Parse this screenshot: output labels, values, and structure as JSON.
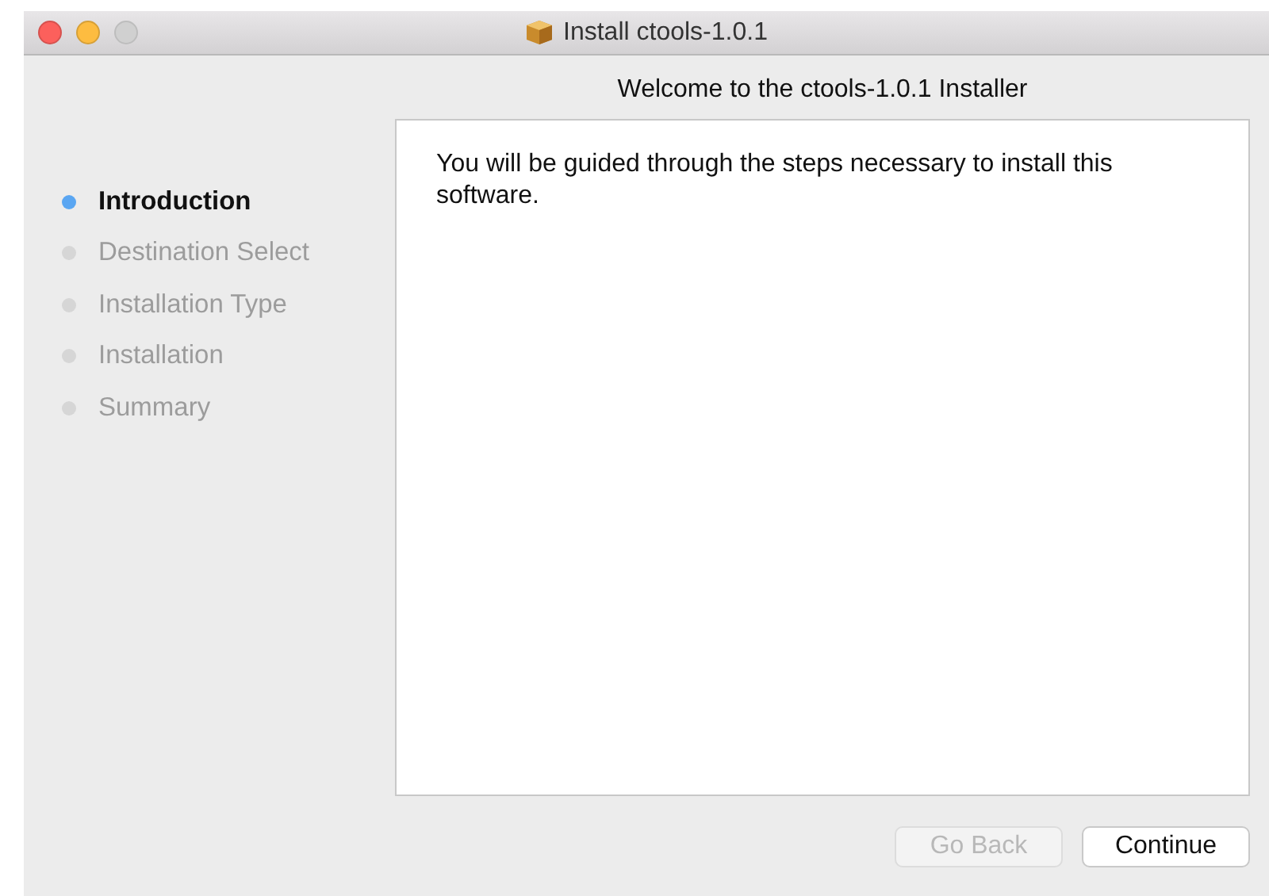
{
  "window": {
    "title": "Install ctools-1.0.1",
    "controls": [
      {
        "kind": "close",
        "disabled": false
      },
      {
        "kind": "minimize",
        "disabled": false
      },
      {
        "kind": "zoom",
        "disabled": true
      }
    ]
  },
  "heading": "Welcome to the ctools-1.0.1 Installer",
  "steps": [
    {
      "label": "Introduction",
      "selected": true
    },
    {
      "label": "Destination Select",
      "selected": false
    },
    {
      "label": "Installation Type",
      "selected": false
    },
    {
      "label": "Installation",
      "selected": false
    },
    {
      "label": "Summary",
      "selected": false
    }
  ],
  "content": "You will be guided through the steps necessary to install this software.",
  "buttons": [
    {
      "label": "Go Back",
      "disabled": true
    },
    {
      "label": "Continue",
      "disabled": false
    }
  ]
}
